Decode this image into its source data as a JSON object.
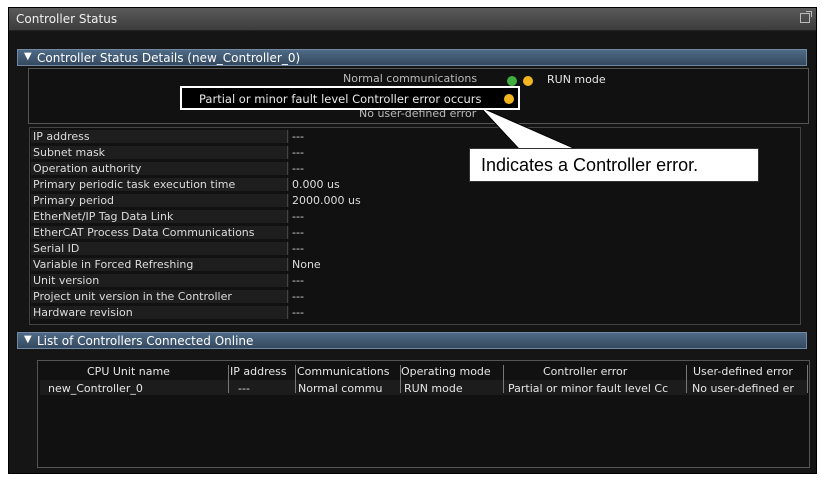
{
  "window": {
    "title": "Controller Status"
  },
  "details": {
    "header": "Controller Status Details (new_Controller_0)",
    "status": {
      "communications": "Normal communications",
      "run_mode": "RUN mode",
      "error": "Partial or minor fault level Controller error occurs",
      "user_error": "No user-defined error"
    },
    "properties": [
      {
        "key": "IP address",
        "value": "---"
      },
      {
        "key": "Subnet mask",
        "value": "---"
      },
      {
        "key": "Operation authority",
        "value": "---"
      },
      {
        "key": "Primary periodic task execution time",
        "value": "0.000 us"
      },
      {
        "key": "Primary period",
        "value": "2000.000 us"
      },
      {
        "key": "EtherNet/IP Tag Data Link",
        "value": "---"
      },
      {
        "key": "EtherCAT Process Data Communications",
        "value": "---"
      },
      {
        "key": "Serial ID",
        "value": "---"
      },
      {
        "key": "Variable in Forced Refreshing",
        "value": "None"
      },
      {
        "key": "Unit version",
        "value": "---"
      },
      {
        "key": "Project unit version in the Controller",
        "value": "---"
      },
      {
        "key": "Hardware revision",
        "value": "---"
      }
    ]
  },
  "callout": {
    "text": "Indicates a Controller error."
  },
  "list": {
    "header": "List of Controllers Connected Online",
    "columns": [
      "CPU Unit name",
      "IP address",
      "Communications",
      "Operating mode",
      "Controller error",
      "User-defined error"
    ],
    "rows": [
      [
        "new_Controller_0",
        "---",
        "Normal commu",
        "RUN mode",
        "Partial or minor fault level Cc",
        "No user-defined er"
      ]
    ]
  },
  "colors": {
    "status_green": "#3fae3f",
    "status_yellow": "#f2b51f",
    "header_blue": "#3f5a78"
  },
  "icons": {
    "maximize": "maximize-icon",
    "collapse": "triangle-down-icon"
  }
}
